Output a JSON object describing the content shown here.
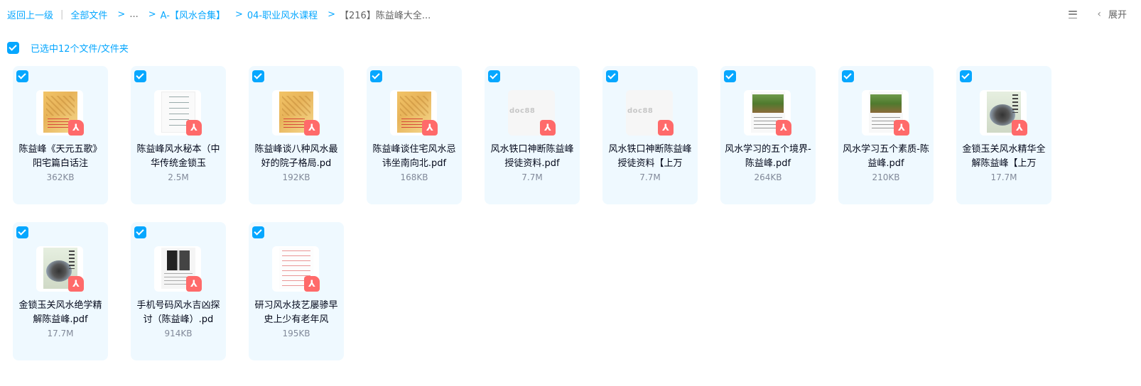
{
  "breadcrumb": {
    "back": "返回上一级",
    "all_files": "全部文件",
    "ellipsis": "...",
    "items": [
      "A-【风水合集】",
      "04-职业风水课程",
      "【216】陈益峰大全..."
    ]
  },
  "toolbar": {
    "expand_label": "展开",
    "list_view_icon": "list-view-icon",
    "chevron_icon": "chevron-left-icon"
  },
  "selection": {
    "summary": "已选中12个文件/文件夹"
  },
  "colors": {
    "accent": "#06a7ff",
    "card_bg": "#eff9ff",
    "pdf_badge": "#ff6a6a"
  },
  "files": [
    {
      "name": "陈益峰《天元五歌》阳宅篇白话注",
      "size": "362KB",
      "thumb": "map"
    },
    {
      "name": "陈益峰风水秘本（中华传统金锁玉",
      "size": "2.5M",
      "thumb": "text"
    },
    {
      "name": "陈益峰谈八种风水最好的院子格局.pd",
      "size": "192KB",
      "thumb": "map"
    },
    {
      "name": "陈益峰谈住宅风水忌讳坐南向北.pdf",
      "size": "168KB",
      "thumb": "map"
    },
    {
      "name": "风水铁口神断陈益峰授徒资料.pdf",
      "size": "7.7M",
      "thumb": "doc88"
    },
    {
      "name": "风水铁口神断陈益峰授徒资料【上万",
      "size": "7.7M",
      "thumb": "doc88"
    },
    {
      "name": "风水学习的五个境界-陈益峰.pdf",
      "size": "264KB",
      "thumb": "photo"
    },
    {
      "name": "风水学习五个素质-陈益峰.pdf",
      "size": "210KB",
      "thumb": "photo"
    },
    {
      "name": "金锁玉关风水精华全解陈益峰【上万",
      "size": "17.7M",
      "thumb": "book"
    },
    {
      "name": "金锁玉关风水绝学精解陈益峰.pdf",
      "size": "17.7M",
      "thumb": "book"
    },
    {
      "name": "手机号码风水吉凶探讨（陈益峰）.pd",
      "size": "914KB",
      "thumb": "phone"
    },
    {
      "name": "研习风水技艺屡骖早 史上少有老年风",
      "size": "195KB",
      "thumb": "red"
    }
  ],
  "file_icon": "pdf-icon",
  "thumb_watermark": "doc88"
}
